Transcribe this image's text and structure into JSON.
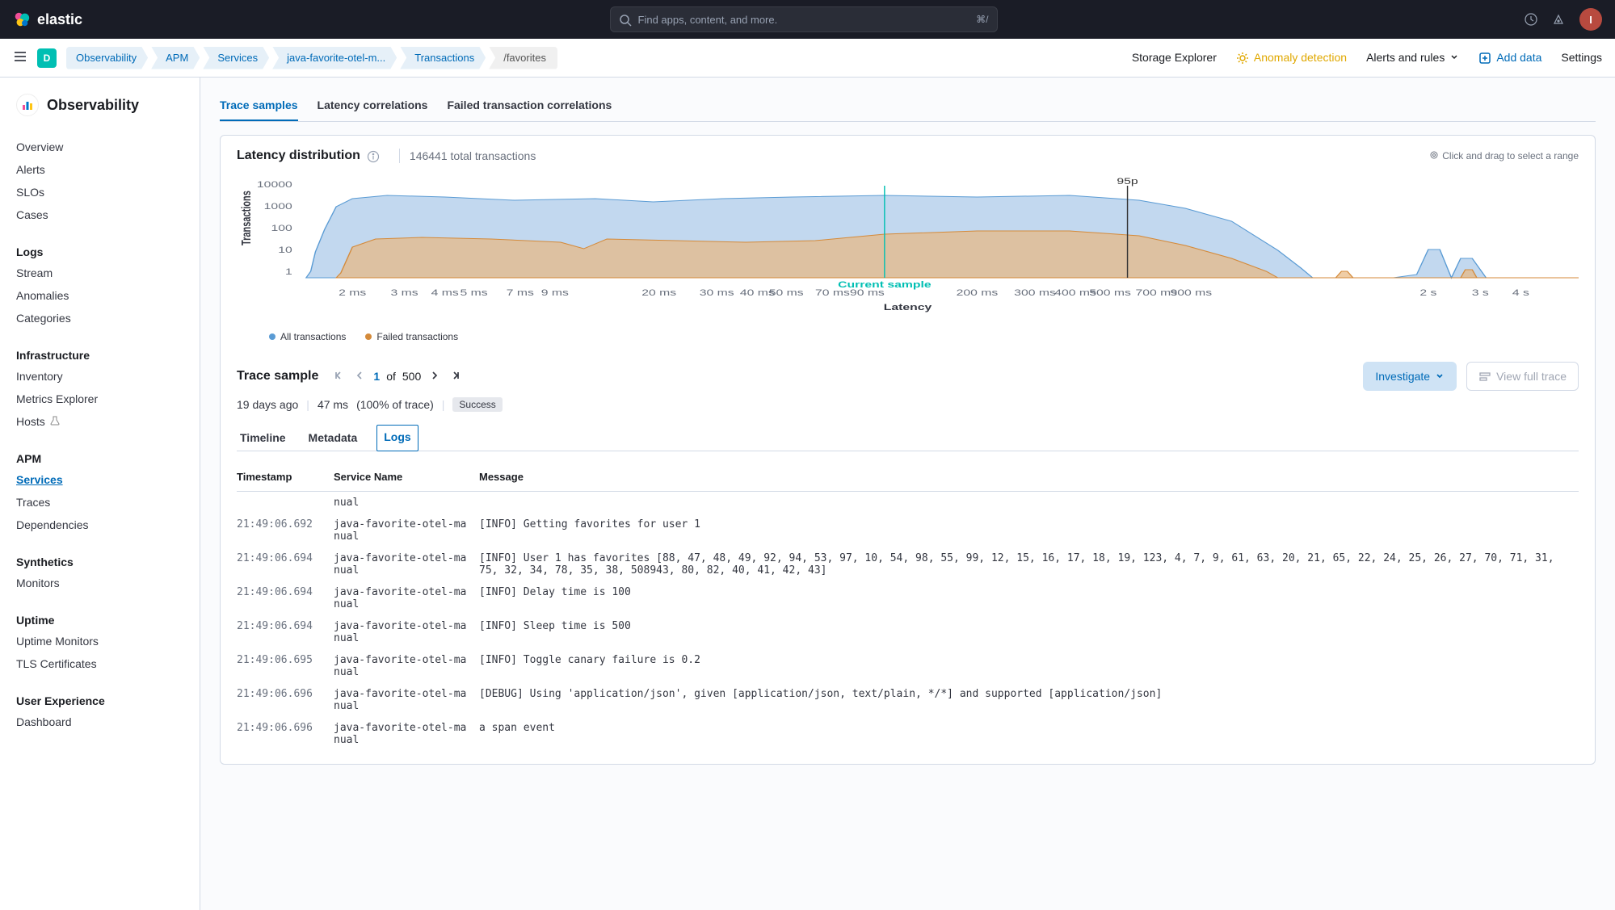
{
  "header": {
    "brand": "elastic",
    "search_placeholder": "Find apps, content, and more.",
    "search_kbd": "⌘/",
    "avatar_initial": "I"
  },
  "subheader": {
    "deployment_badge": "D",
    "breadcrumbs": [
      "Observability",
      "APM",
      "Services",
      "java-favorite-otel-m...",
      "Transactions",
      "/favorites"
    ],
    "links": {
      "storage": "Storage Explorer",
      "anomaly": "Anomaly detection",
      "alerts": "Alerts and rules",
      "add_data": "Add data",
      "settings": "Settings"
    }
  },
  "sidebar": {
    "title": "Observability",
    "groups": [
      {
        "title": "",
        "items": [
          "Overview",
          "Alerts",
          "SLOs",
          "Cases"
        ]
      },
      {
        "title": "Logs",
        "items": [
          "Stream",
          "Anomalies",
          "Categories"
        ]
      },
      {
        "title": "Infrastructure",
        "items": [
          "Inventory",
          "Metrics Explorer",
          "Hosts"
        ]
      },
      {
        "title": "APM",
        "items": [
          "Services",
          "Traces",
          "Dependencies"
        ],
        "active": "Services"
      },
      {
        "title": "Synthetics",
        "items": [
          "Monitors"
        ]
      },
      {
        "title": "Uptime",
        "items": [
          "Uptime Monitors",
          "TLS Certificates"
        ]
      },
      {
        "title": "User Experience",
        "items": [
          "Dashboard"
        ]
      }
    ]
  },
  "tabs": {
    "items": [
      "Trace samples",
      "Latency correlations",
      "Failed transaction correlations"
    ],
    "active": "Trace samples"
  },
  "latency_panel": {
    "title": "Latency distribution",
    "total": "146441 total transactions",
    "hint": "Click and drag to select a range",
    "marker_95p": "95p",
    "marker_current": "Current sample",
    "legend": {
      "all": "All transactions",
      "failed": "Failed transactions"
    },
    "y_title": "Transactions",
    "x_title": "Latency"
  },
  "chart_data": {
    "type": "area",
    "y_ticks": [
      "10000",
      "1000",
      "100",
      "10",
      "1"
    ],
    "x_ticks": [
      "2 ms",
      "3 ms",
      "4 ms",
      "5 ms",
      "7 ms",
      "9 ms",
      "20 ms",
      "30 ms",
      "40 ms",
      "50 ms",
      "70 ms",
      "90 ms",
      "200 ms",
      "300 ms",
      "400 ms",
      "500 ms",
      "700 ms",
      "900 ms",
      "2 s",
      "3 s",
      "4 s"
    ],
    "series": [
      {
        "name": "All transactions",
        "color": "#a8c8e8"
      },
      {
        "name": "Failed transactions",
        "color": "#e8b880"
      }
    ],
    "markers": {
      "p95_x_frac": 0.66,
      "current_x_frac": 0.48
    }
  },
  "trace_sample": {
    "title": "Trace sample",
    "page": "1",
    "of": "of",
    "total": "500",
    "investigate": "Investigate",
    "view_full": "View full trace",
    "meta": {
      "age": "19 days ago",
      "duration": "47 ms",
      "pct": "(100% of trace)",
      "status": "Success"
    },
    "inner_tabs": [
      "Timeline",
      "Metadata",
      "Logs"
    ],
    "inner_active": "Logs"
  },
  "log_table": {
    "headers": {
      "ts": "Timestamp",
      "svc": "Service Name",
      "msg": "Message"
    },
    "rows": [
      {
        "ts": "",
        "svc": "nual",
        "msg": ""
      },
      {
        "ts": "21:49:06.692",
        "svc": "java-favorite-otel-manual",
        "msg": "[INFO] Getting favorites for user 1"
      },
      {
        "ts": "21:49:06.694",
        "svc": "java-favorite-otel-manual",
        "msg": "[INFO] User 1 has favorites [88, 47, 48, 49, 92, 94, 53, 97, 10, 54, 98, 55, 99, 12, 15, 16, 17, 18, 19, 123, 4, 7, 9, 61, 63, 20, 21, 65, 22, 24, 25, 26, 27, 70, 71, 31, 75, 32, 34, 78, 35, 38, 508943, 80, 82, 40, 41, 42, 43]"
      },
      {
        "ts": "21:49:06.694",
        "svc": "java-favorite-otel-manual",
        "msg": "[INFO] Delay time is 100"
      },
      {
        "ts": "21:49:06.694",
        "svc": "java-favorite-otel-manual",
        "msg": "[INFO] Sleep time is 500"
      },
      {
        "ts": "21:49:06.695",
        "svc": "java-favorite-otel-manual",
        "msg": "[INFO] Toggle canary failure is 0.2"
      },
      {
        "ts": "21:49:06.696",
        "svc": "java-favorite-otel-manual",
        "msg": "[DEBUG] Using 'application/json', given [application/json, text/plain, */*] and supported [application/json]"
      },
      {
        "ts": "21:49:06.696",
        "svc": "java-favorite-otel-manual",
        "msg": "a span event"
      }
    ]
  }
}
